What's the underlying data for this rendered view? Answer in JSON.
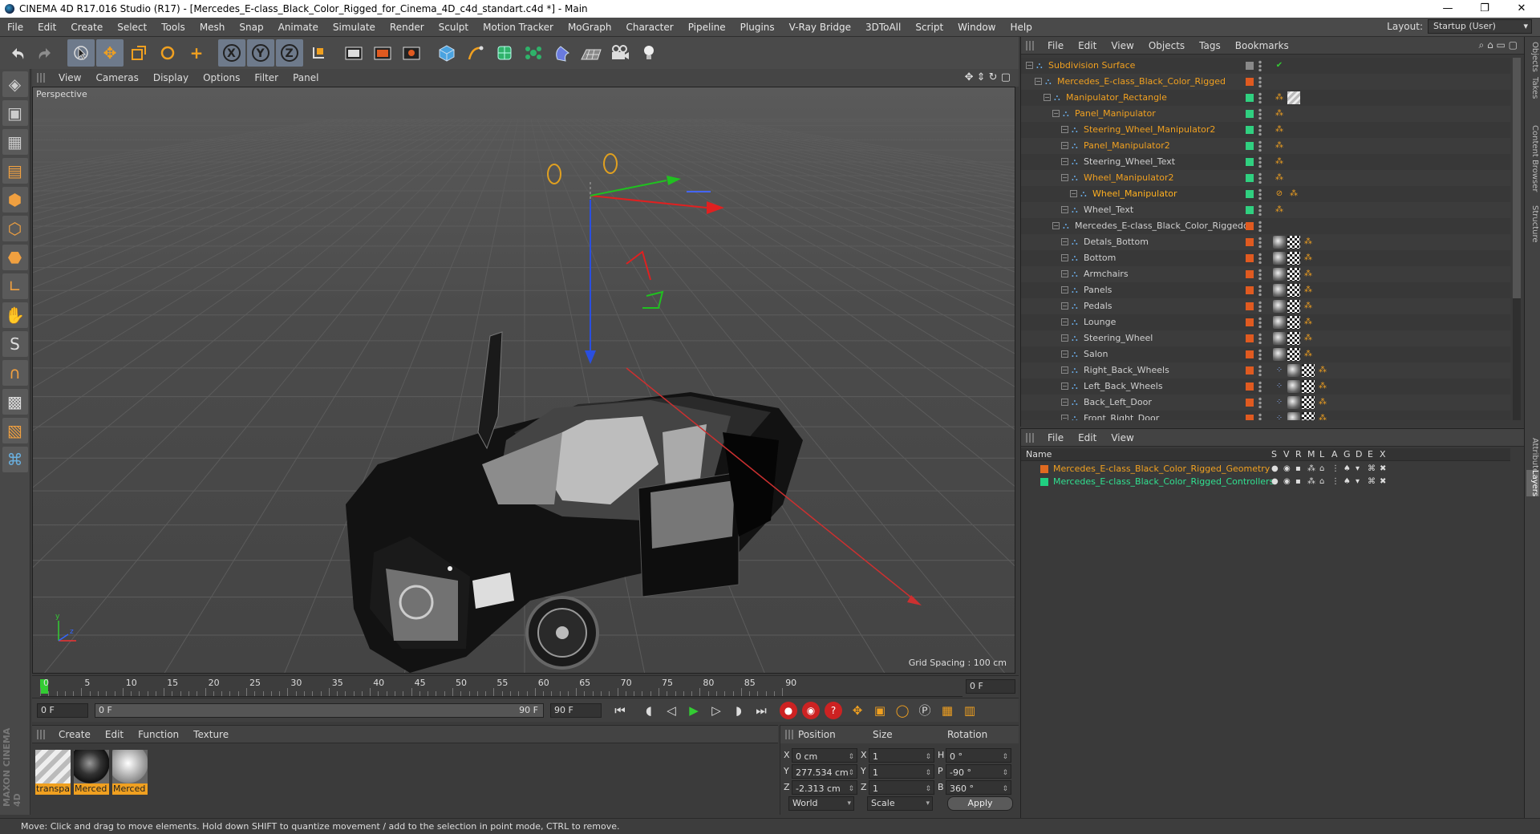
{
  "window": {
    "title": "CINEMA 4D R17.016 Studio (R17) - [Mercedes_E-class_Black_Color_Rigged_for_Cinema_4D_c4d_standart.c4d *] - Main",
    "minimize": "—",
    "maximize": "❐",
    "close": "✕"
  },
  "menubar": {
    "items": [
      "File",
      "Edit",
      "Create",
      "Select",
      "Tools",
      "Mesh",
      "Snap",
      "Animate",
      "Simulate",
      "Render",
      "Sculpt",
      "Motion Tracker",
      "MoGraph",
      "Character",
      "Pipeline",
      "Plugins",
      "V-Ray Bridge",
      "3DToAll",
      "Script",
      "Window",
      "Help"
    ],
    "layout_label": "Layout:",
    "layout_value": "Startup (User)"
  },
  "toolbar": {
    "icons": [
      "undo-icon",
      "redo-icon",
      "live-select-icon",
      "move-icon",
      "scale-icon",
      "rotate-icon",
      "recent-tools-icon",
      "x-axis-icon",
      "y-axis-icon",
      "z-axis-icon",
      "world-coordinates-icon",
      "render-view-icon",
      "render-picture-viewer-icon",
      "edit-render-settings-icon",
      "cube-icon",
      "pen-icon",
      "subdivision-icon",
      "array-icon",
      "deformer-icon",
      "floor-icon",
      "camera-icon",
      "light-icon"
    ]
  },
  "viewport": {
    "menu": [
      "View",
      "Cameras",
      "Display",
      "Options",
      "Filter",
      "Panel"
    ],
    "label": "Perspective",
    "grid_spacing": "Grid Spacing : 100 cm"
  },
  "timeline": {
    "ticks": [
      "0",
      "5",
      "10",
      "15",
      "20",
      "25",
      "30",
      "35",
      "40",
      "45",
      "50",
      "55",
      "60",
      "65",
      "70",
      "75",
      "80",
      "85",
      "90"
    ],
    "current_frame": "0 F",
    "start": "0 F",
    "range_start": "0 F",
    "range_end": "90 F",
    "end": "90 F"
  },
  "material_manager": {
    "menu": [
      "Create",
      "Edit",
      "Function",
      "Texture"
    ],
    "materials": [
      {
        "label": "transpa"
      },
      {
        "label": "Merced"
      },
      {
        "label": "Merced"
      }
    ]
  },
  "coordinates": {
    "headers": {
      "position": "Position",
      "size": "Size",
      "rotation": "Rotation"
    },
    "rows": [
      {
        "axis": "X",
        "pos": "0 cm",
        "size_axis": "X",
        "size": "1",
        "rot_axis": "H",
        "rot": "0 °"
      },
      {
        "axis": "Y",
        "pos": "277.534 cm",
        "size_axis": "Y",
        "size": "1",
        "rot_axis": "P",
        "rot": "-90 °"
      },
      {
        "axis": "Z",
        "pos": "-2.313 cm",
        "size_axis": "Z",
        "size": "1",
        "rot_axis": "B",
        "rot": "360 °"
      }
    ],
    "mode": "World",
    "size_mode": "Scale",
    "apply": "Apply"
  },
  "object_manager": {
    "menu": [
      "File",
      "Edit",
      "View",
      "Objects",
      "Tags",
      "Bookmarks"
    ],
    "objects": [
      {
        "name": "Subdivision Surface",
        "depth": 0,
        "color": "#f0a020",
        "dot": "#888888",
        "tags": [
          "check"
        ]
      },
      {
        "name": "Mercedes_E-class_Black_Color_Rigged",
        "depth": 1,
        "color": "#f0a020",
        "dot": "#e05a20",
        "tags": []
      },
      {
        "name": "Manipulator_Rectangle",
        "depth": 2,
        "color": "#f0a020",
        "dot": "#30d080",
        "tags": [
          "dots",
          "tex"
        ]
      },
      {
        "name": "Panel_Manipulator",
        "depth": 3,
        "color": "#f0a020",
        "dot": "#30d080",
        "tags": [
          "dots"
        ]
      },
      {
        "name": "Steering_Wheel_Manipulator2",
        "depth": 4,
        "color": "#f0a020",
        "dot": "#30d080",
        "tags": [
          "dots"
        ]
      },
      {
        "name": "Panel_Manipulator2",
        "depth": 4,
        "color": "#f0a020",
        "dot": "#30d080",
        "tags": [
          "dots"
        ]
      },
      {
        "name": "Steering_Wheel_Text",
        "depth": 4,
        "color": "#cfcfcf",
        "dot": "#30d080",
        "tags": [
          "dots"
        ]
      },
      {
        "name": "Wheel_Manipulator2",
        "depth": 4,
        "color": "#f0a020",
        "dot": "#30d080",
        "tags": [
          "dots"
        ]
      },
      {
        "name": "Wheel_Manipulator",
        "depth": 5,
        "color": "#ffb020",
        "dot": "#30d080",
        "tags": [
          "no",
          "dots"
        ]
      },
      {
        "name": "Wheel_Text",
        "depth": 4,
        "color": "#cfcfcf",
        "dot": "#30d080",
        "tags": [
          "dots"
        ]
      },
      {
        "name": "Mercedes_E-class_Black_Color_Riggedd",
        "depth": 3,
        "color": "#cfcfcf",
        "dot": "#e05a20",
        "tags": []
      },
      {
        "name": "Detals_Bottom",
        "depth": 4,
        "color": "#cfcfcf",
        "dot": "#e05a20",
        "tags": [
          "mat",
          "chk",
          "dots"
        ]
      },
      {
        "name": "Bottom",
        "depth": 4,
        "color": "#cfcfcf",
        "dot": "#e05a20",
        "tags": [
          "mat",
          "chk",
          "dots"
        ]
      },
      {
        "name": "Armchairs",
        "depth": 4,
        "color": "#cfcfcf",
        "dot": "#e05a20",
        "tags": [
          "mat",
          "chk",
          "dots"
        ]
      },
      {
        "name": "Panels",
        "depth": 4,
        "color": "#cfcfcf",
        "dot": "#e05a20",
        "tags": [
          "mat",
          "chk",
          "dots"
        ]
      },
      {
        "name": "Pedals",
        "depth": 4,
        "color": "#cfcfcf",
        "dot": "#e05a20",
        "tags": [
          "mat",
          "chk",
          "dots"
        ]
      },
      {
        "name": "Lounge",
        "depth": 4,
        "color": "#cfcfcf",
        "dot": "#e05a20",
        "tags": [
          "mat",
          "chk",
          "dots"
        ]
      },
      {
        "name": "Steering_Wheel",
        "depth": 4,
        "color": "#cfcfcf",
        "dot": "#e05a20",
        "tags": [
          "mat",
          "chk",
          "dots"
        ]
      },
      {
        "name": "Salon",
        "depth": 4,
        "color": "#cfcfcf",
        "dot": "#e05a20",
        "tags": [
          "mat",
          "chk",
          "dots"
        ]
      },
      {
        "name": "Right_Back_Wheels",
        "depth": 4,
        "color": "#cfcfcf",
        "dot": "#e05a20",
        "tags": [
          "pts",
          "mat",
          "chk",
          "dots"
        ]
      },
      {
        "name": "Left_Back_Wheels",
        "depth": 4,
        "color": "#cfcfcf",
        "dot": "#e05a20",
        "tags": [
          "pts",
          "mat",
          "chk",
          "dots"
        ]
      },
      {
        "name": "Back_Left_Door",
        "depth": 4,
        "color": "#cfcfcf",
        "dot": "#e05a20",
        "tags": [
          "pts",
          "mat",
          "chk",
          "dots"
        ]
      },
      {
        "name": "Front_Right_Door",
        "depth": 4,
        "color": "#cfcfcf",
        "dot": "#e05a20",
        "tags": [
          "pts",
          "mat",
          "chk",
          "dots"
        ]
      }
    ]
  },
  "layer_manager": {
    "menu": [
      "File",
      "Edit",
      "View"
    ],
    "columns": [
      "Name",
      "S",
      "V",
      "R",
      "M",
      "L",
      "A",
      "G",
      "D",
      "E",
      "X"
    ],
    "layers": [
      {
        "name": "Mercedes_E-class_Black_Color_Rigged_Geometry",
        "color": "#e06a20",
        "text_color": "#f0a020"
      },
      {
        "name": "Mercedes_E-class_Black_Color_Rigged_Controllers",
        "color": "#20d080",
        "text_color": "#30e090"
      }
    ]
  },
  "right_tabs": [
    "Objects",
    "Takes",
    "Content Browser",
    "Structure",
    "Attributes",
    "Layers"
  ],
  "status": "Move: Click and drag to move elements. Hold down SHIFT to quantize movement / add to the selection in point mode, CTRL to remove.",
  "maxon_logo": "MAXON CINEMA 4D"
}
